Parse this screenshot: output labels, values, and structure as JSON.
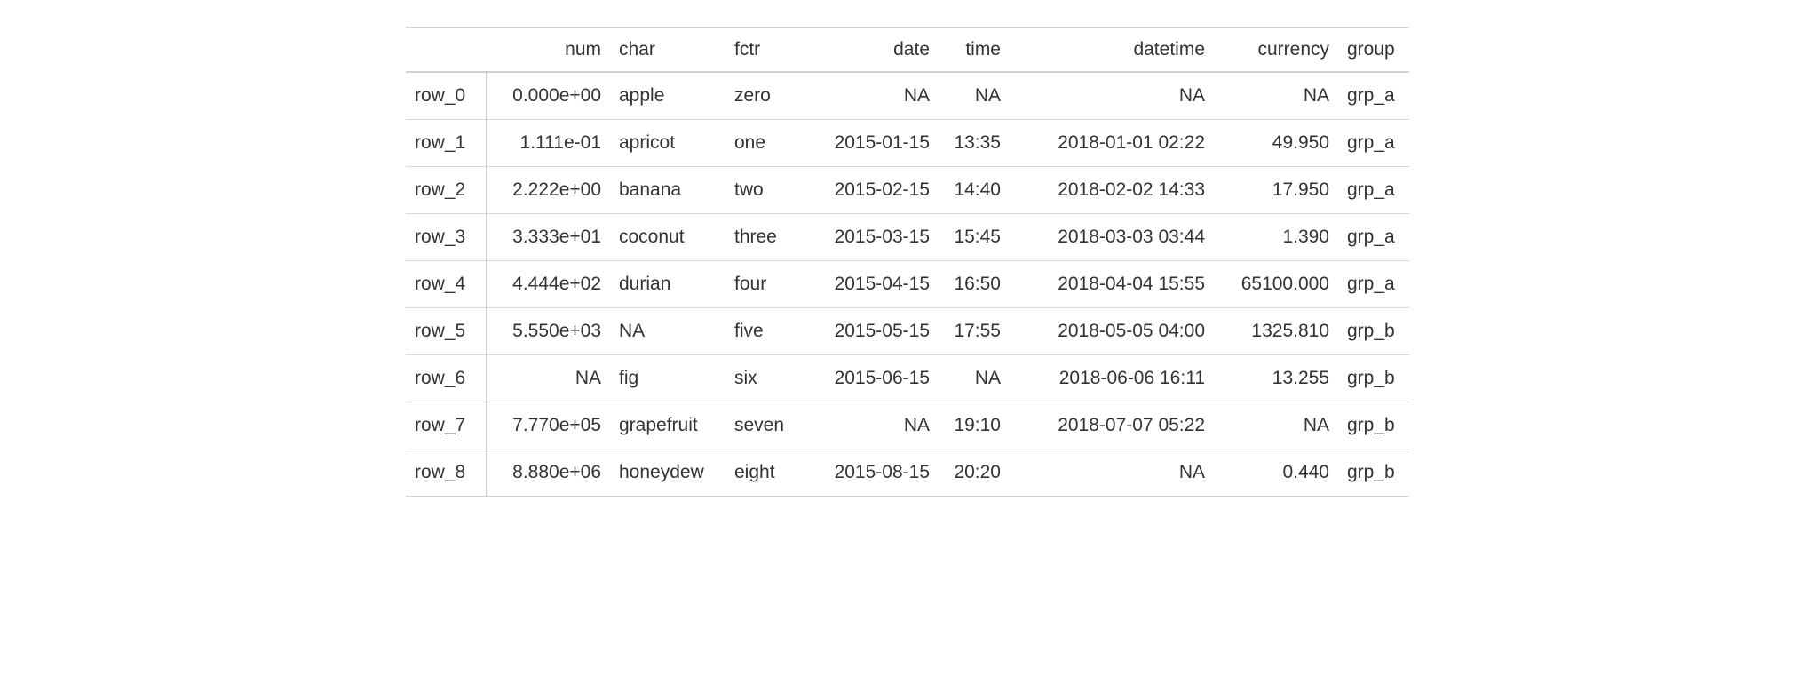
{
  "table": {
    "headers": {
      "stub": "",
      "num": "num",
      "char": "char",
      "fctr": "fctr",
      "date": "date",
      "time": "time",
      "datetime": "datetime",
      "currency": "currency",
      "group": "group"
    },
    "rows": [
      {
        "stub": "row_0",
        "num": "0.000e+00",
        "char": "apple",
        "fctr": "zero",
        "date": "NA",
        "time": "NA",
        "datetime": "NA",
        "currency": "NA",
        "group": "grp_a"
      },
      {
        "stub": "row_1",
        "num": "1.111e-01",
        "char": "apricot",
        "fctr": "one",
        "date": "2015-01-15",
        "time": "13:35",
        "datetime": "2018-01-01 02:22",
        "currency": "49.950",
        "group": "grp_a"
      },
      {
        "stub": "row_2",
        "num": "2.222e+00",
        "char": "banana",
        "fctr": "two",
        "date": "2015-02-15",
        "time": "14:40",
        "datetime": "2018-02-02 14:33",
        "currency": "17.950",
        "group": "grp_a"
      },
      {
        "stub": "row_3",
        "num": "3.333e+01",
        "char": "coconut",
        "fctr": "three",
        "date": "2015-03-15",
        "time": "15:45",
        "datetime": "2018-03-03 03:44",
        "currency": "1.390",
        "group": "grp_a"
      },
      {
        "stub": "row_4",
        "num": "4.444e+02",
        "char": "durian",
        "fctr": "four",
        "date": "2015-04-15",
        "time": "16:50",
        "datetime": "2018-04-04 15:55",
        "currency": "65100.000",
        "group": "grp_a"
      },
      {
        "stub": "row_5",
        "num": "5.550e+03",
        "char": "NA",
        "fctr": "five",
        "date": "2015-05-15",
        "time": "17:55",
        "datetime": "2018-05-05 04:00",
        "currency": "1325.810",
        "group": "grp_b"
      },
      {
        "stub": "row_6",
        "num": "NA",
        "char": "fig",
        "fctr": "six",
        "date": "2015-06-15",
        "time": "NA",
        "datetime": "2018-06-06 16:11",
        "currency": "13.255",
        "group": "grp_b"
      },
      {
        "stub": "row_7",
        "num": "7.770e+05",
        "char": "grapefruit",
        "fctr": "seven",
        "date": "NA",
        "time": "19:10",
        "datetime": "2018-07-07 05:22",
        "currency": "NA",
        "group": "grp_b"
      },
      {
        "stub": "row_8",
        "num": "8.880e+06",
        "char": "honeydew",
        "fctr": "eight",
        "date": "2015-08-15",
        "time": "20:20",
        "datetime": "NA",
        "currency": "0.440",
        "group": "grp_b"
      }
    ]
  }
}
